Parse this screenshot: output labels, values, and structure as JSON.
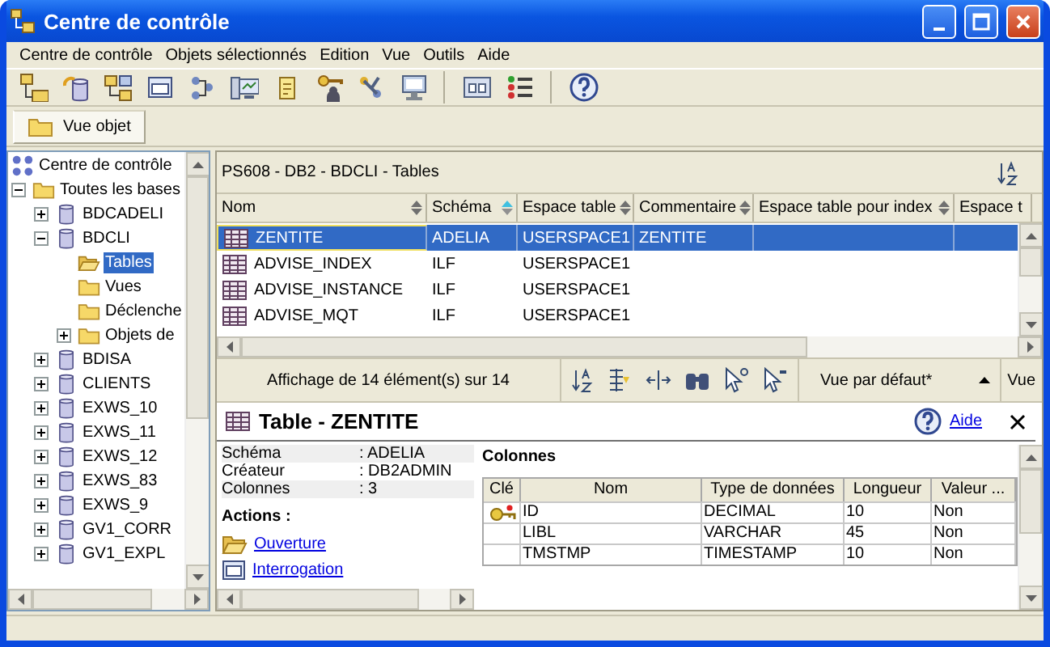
{
  "window": {
    "title": "Centre de contrôle"
  },
  "menu": [
    {
      "label": "Centre de contrôle"
    },
    {
      "label": "Objets sélectionnés"
    },
    {
      "label": "Edition"
    },
    {
      "label": "Vue"
    },
    {
      "label": "Outils"
    },
    {
      "label": "Aide"
    }
  ],
  "view_tabs": [
    {
      "label": "Vue objet",
      "selected": true
    }
  ],
  "tree": [
    {
      "label": "Centre de contrôle",
      "kind": "root",
      "selected": false,
      "children": [
        {
          "label": "Toutes les bases",
          "kind": "folder",
          "expanded": true,
          "selected": false,
          "children": [
            {
              "label": "BDCADELI",
              "kind": "database",
              "expanded": false,
              "selected": false
            },
            {
              "label": "BDCLI",
              "kind": "database",
              "expanded": true,
              "selected": false,
              "children": [
                {
                  "label": "Tables",
                  "kind": "folder-open",
                  "selected": true
                },
                {
                  "label": "Vues",
                  "kind": "folder",
                  "selected": false
                },
                {
                  "label": "Déclenche",
                  "kind": "folder",
                  "selected": false
                },
                {
                  "label": "Objets de",
                  "kind": "folder",
                  "expanded": false,
                  "selected": false
                }
              ]
            },
            {
              "label": "BDISA",
              "kind": "database",
              "expanded": false,
              "selected": false
            },
            {
              "label": "CLIENTS",
              "kind": "database",
              "expanded": false,
              "selected": false
            },
            {
              "label": "EXWS_10",
              "kind": "database",
              "expanded": false,
              "selected": false
            },
            {
              "label": "EXWS_11",
              "kind": "database",
              "expanded": false,
              "selected": false
            },
            {
              "label": "EXWS_12",
              "kind": "database",
              "expanded": false,
              "selected": false
            },
            {
              "label": "EXWS_83",
              "kind": "database",
              "expanded": false,
              "selected": false
            },
            {
              "label": "EXWS_9",
              "kind": "database",
              "expanded": false,
              "selected": false
            },
            {
              "label": "GV1_CORR",
              "kind": "database",
              "expanded": false,
              "selected": false
            },
            {
              "label": "GV1_EXPL",
              "kind": "database",
              "expanded": false,
              "selected": false
            }
          ]
        }
      ]
    }
  ],
  "table": {
    "breadcrumb": "PS608 - DB2 - BDCLI - Tables",
    "columns": [
      {
        "label": "Nom",
        "sorted": false
      },
      {
        "label": "Schéma",
        "sorted": true
      },
      {
        "label": "Espace table",
        "sorted": false
      },
      {
        "label": "Commentaire",
        "sorted": false
      },
      {
        "label": "Espace table pour index",
        "sorted": false
      },
      {
        "label": "Espace t"
      }
    ],
    "rows": [
      {
        "cells": [
          "ZENTITE",
          "ADELIA",
          "USERSPACE1",
          "ZENTITE"
        ],
        "selected": true
      },
      {
        "cells": [
          "ADVISE_INDEX",
          "ILF",
          "USERSPACE1"
        ],
        "selected": false
      },
      {
        "cells": [
          "ADVISE_INSTANCE",
          "ILF",
          "USERSPACE1"
        ],
        "selected": false
      },
      {
        "cells": [
          "ADVISE_MQT",
          "ILF",
          "USERSPACE1"
        ],
        "selected": false
      }
    ]
  },
  "footer": {
    "count": "Affichage de 14 élément(s) sur 14",
    "view": "Vue par défaut*",
    "view_button": "Vue"
  },
  "details": {
    "title": "Table - ZENTITE",
    "help": "Aide",
    "properties": [
      {
        "label": "Schéma",
        "value": ": ADELIA"
      },
      {
        "label": "Créateur",
        "value": ": DB2ADMIN"
      },
      {
        "label": "Colonnes",
        "value": ": 3"
      }
    ],
    "actions_heading": "Actions :",
    "actions": [
      {
        "label": "Ouverture",
        "kind": "open"
      },
      {
        "label": "Interrogation",
        "kind": "query"
      }
    ],
    "columns_heading": "Colonnes",
    "key_column": "Clé",
    "columns": [
      "Nom",
      "Type de données",
      "Longueur",
      "Valeur ..."
    ],
    "rows": [
      {
        "key": true,
        "cells": [
          "ID",
          "DECIMAL",
          "10",
          "Non"
        ]
      },
      {
        "key": false,
        "cells": [
          "LIBL",
          "VARCHAR",
          "45",
          "Non"
        ]
      },
      {
        "key": false,
        "cells": [
          "TMSTMP",
          "TIMESTAMP",
          "10",
          "Non"
        ]
      }
    ]
  }
}
